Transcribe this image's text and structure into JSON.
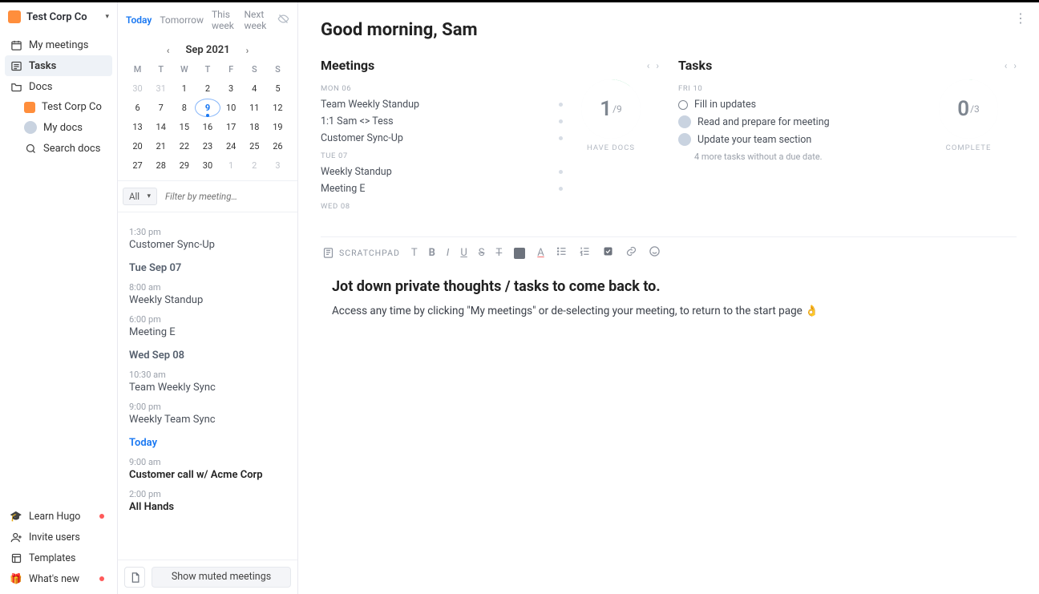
{
  "workspace": {
    "name": "Test Corp Co"
  },
  "sidebar": {
    "items": [
      {
        "id": "my-meetings",
        "label": "My meetings",
        "icon": "calendar"
      },
      {
        "id": "tasks",
        "label": "Tasks",
        "icon": "tasks",
        "active": true
      },
      {
        "id": "docs",
        "label": "Docs",
        "icon": "folder"
      }
    ],
    "docs_children": [
      {
        "id": "ws-docs",
        "label": "Test Corp Co",
        "icon": "ws"
      },
      {
        "id": "my-docs",
        "label": "My docs",
        "icon": "avatar"
      },
      {
        "id": "search-docs",
        "label": "Search docs",
        "icon": "search"
      }
    ],
    "footer": [
      {
        "id": "learn",
        "label": "Learn Hugo",
        "icon": "grad",
        "dot": true
      },
      {
        "id": "invite",
        "label": "Invite users",
        "icon": "invite",
        "dot": false
      },
      {
        "id": "templates",
        "label": "Templates",
        "icon": "template",
        "dot": false
      },
      {
        "id": "whatsnew",
        "label": "What's new",
        "icon": "gift",
        "dot": true
      }
    ]
  },
  "range_tabs": [
    "Today",
    "Tomorrow",
    "This week",
    "Next week"
  ],
  "range_active": "Today",
  "calendar": {
    "month_label": "Sep 2021",
    "day_heads": [
      "M",
      "T",
      "W",
      "T",
      "F",
      "S",
      "S"
    ],
    "cells": [
      {
        "d": "30",
        "muted": true
      },
      {
        "d": "31",
        "muted": true
      },
      {
        "d": "1"
      },
      {
        "d": "2"
      },
      {
        "d": "3"
      },
      {
        "d": "4"
      },
      {
        "d": "5"
      },
      {
        "d": "6"
      },
      {
        "d": "7"
      },
      {
        "d": "8"
      },
      {
        "d": "9",
        "today": true
      },
      {
        "d": "10"
      },
      {
        "d": "11"
      },
      {
        "d": "12"
      },
      {
        "d": "13"
      },
      {
        "d": "14"
      },
      {
        "d": "15"
      },
      {
        "d": "16"
      },
      {
        "d": "17"
      },
      {
        "d": "18"
      },
      {
        "d": "19"
      },
      {
        "d": "20"
      },
      {
        "d": "21"
      },
      {
        "d": "22"
      },
      {
        "d": "23"
      },
      {
        "d": "24"
      },
      {
        "d": "25"
      },
      {
        "d": "26"
      },
      {
        "d": "27"
      },
      {
        "d": "28"
      },
      {
        "d": "29"
      },
      {
        "d": "30"
      },
      {
        "d": "1",
        "muted": true
      },
      {
        "d": "2",
        "muted": true
      },
      {
        "d": "3",
        "muted": true
      }
    ]
  },
  "filter": {
    "select_label": "All",
    "placeholder": "Filter by meeting…"
  },
  "events": [
    {
      "type": "time",
      "text": "1:30 pm"
    },
    {
      "type": "title",
      "text": "Customer Sync-Up"
    },
    {
      "type": "day",
      "text": "Tue Sep 07"
    },
    {
      "type": "time",
      "text": "8:00 am"
    },
    {
      "type": "title",
      "text": "Weekly Standup"
    },
    {
      "type": "time",
      "text": "6:00 pm"
    },
    {
      "type": "title",
      "text": "Meeting E"
    },
    {
      "type": "day",
      "text": "Wed Sep 08"
    },
    {
      "type": "time",
      "text": "10:30 am"
    },
    {
      "type": "title",
      "text": "Team Weekly Sync"
    },
    {
      "type": "time",
      "text": "9:00 pm"
    },
    {
      "type": "title",
      "text": "Weekly Team Sync"
    },
    {
      "type": "day",
      "text": "Today",
      "today": true
    },
    {
      "type": "time",
      "text": "9:00 am"
    },
    {
      "type": "title",
      "text": "Customer call w/ Acme Corp",
      "strong": true
    },
    {
      "type": "time",
      "text": "2:00 pm"
    },
    {
      "type": "title",
      "text": "All Hands",
      "strong": true
    }
  ],
  "timeline_footer": {
    "show_muted": "Show muted meetings"
  },
  "greeting": "Good morning, Sam",
  "meetings_card": {
    "title": "Meetings",
    "groups": [
      {
        "date": "MON 06",
        "items": [
          "Team Weekly Standup",
          "1:1 Sam <> Tess",
          "Customer Sync-Up"
        ]
      },
      {
        "date": "TUE 07",
        "items": [
          "Weekly Standup",
          "Meeting E"
        ]
      },
      {
        "date": "WED 08",
        "items": []
      }
    ],
    "gauge": {
      "num": "1",
      "den": "/9",
      "label": "HAVE DOCS",
      "pct": 11
    }
  },
  "tasks_card": {
    "title": "Tasks",
    "date": "FRI 10",
    "items": [
      {
        "kind": "open",
        "text": "Fill in updates"
      },
      {
        "kind": "avatar",
        "text": "Read and prepare for meeting"
      },
      {
        "kind": "avatar",
        "text": "Update your team section"
      }
    ],
    "more_note": "4 more tasks without a due date.",
    "gauge": {
      "num": "0",
      "den": "/3",
      "label": "COMPLETE",
      "pct": 2
    }
  },
  "scratchpad": {
    "label": "SCRATCHPAD",
    "heading": "Jot down private thoughts / tasks to come back to.",
    "body": "Access any time by clicking \"My meetings\" or de-selecting your meeting, to return to the start page 👌"
  }
}
